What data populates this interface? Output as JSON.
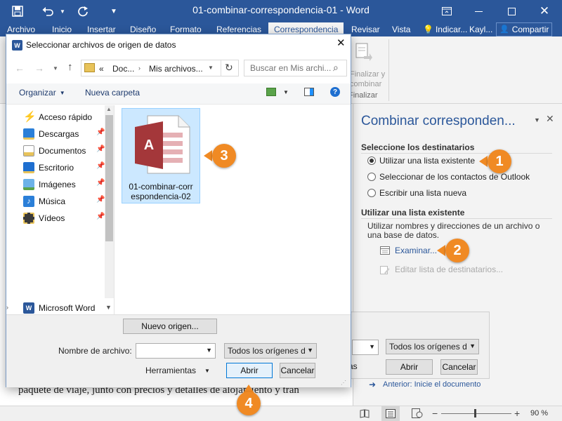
{
  "window": {
    "title": "01-combinar-correspondencia-01 - Word",
    "save_icon": "save-icon",
    "undo_icon": "undo-icon",
    "redo_icon": "redo-icon"
  },
  "ribbon": {
    "tabs": [
      {
        "label": "Archivo"
      },
      {
        "label": "Inicio"
      },
      {
        "label": "Insertar"
      },
      {
        "label": "Diseño"
      },
      {
        "label": "Formato"
      },
      {
        "label": "Referencias"
      },
      {
        "label": "Correspondencia",
        "active": true
      },
      {
        "label": "Revisar"
      },
      {
        "label": "Vista"
      }
    ],
    "tell_me": "Indicar...",
    "user": "Kayl...",
    "share": "Compartir",
    "finish_button_line1": "Finalizar y",
    "finish_button_line2": "combinar",
    "finish_group": "Finalizar"
  },
  "document": {
    "text": "paquete de viaje, junto con precios y detalles de alojamiento y tran"
  },
  "task_pane": {
    "title": "Combinar corresponden...",
    "section1": "Seleccione los destinatarios",
    "options": [
      {
        "label": "Utilizar una lista existente",
        "selected": true
      },
      {
        "label": "Seleccionar de los contactos de Outlook",
        "selected": false
      },
      {
        "label": "Escribir una lista nueva",
        "selected": false
      }
    ],
    "section2": "Utilizar una lista existente",
    "description": "Utilizar nombres y direcciones de un archivo o una base de datos.",
    "browse": "Examinar...",
    "edit_list": "Editar lista de destinatarios...",
    "prev_step": "Anterior: Inicie el documento"
  },
  "behind_dialog": {
    "filter": "Todos los orígenes d",
    "tools_partial": "as",
    "open": "Abrir",
    "cancel": "Cancelar"
  },
  "dialog": {
    "title": "Seleccionar archivos de origen de datos",
    "breadcrumb": [
      "«",
      "Doc...",
      "Mis archivos..."
    ],
    "search_placeholder": "Buscar en Mis archi...",
    "organize": "Organizar",
    "new_folder": "Nueva carpeta",
    "nav": [
      {
        "label": "Acceso rápido",
        "icon": "quick-access-icon",
        "pinned": false
      },
      {
        "label": "Descargas",
        "icon": "downloads-icon",
        "pinned": true
      },
      {
        "label": "Documentos",
        "icon": "documents-icon",
        "pinned": true
      },
      {
        "label": "Escritorio",
        "icon": "desktop-icon",
        "pinned": true
      },
      {
        "label": "Imágenes",
        "icon": "pictures-icon",
        "pinned": true
      },
      {
        "label": "Música",
        "icon": "music-icon",
        "pinned": true
      },
      {
        "label": "Vídeos",
        "icon": "videos-icon",
        "pinned": true
      }
    ],
    "nav_bottom": "Microsoft Word",
    "file": {
      "name": "01-combinar-correspondencia-02",
      "name_line1": "01-combinar-corr",
      "name_line2": "espondencia-02"
    },
    "new_source": "Nuevo origen...",
    "filename_label": "Nombre de archivo:",
    "filename_value": "",
    "filter": "Todos los orígenes d",
    "tools": "Herramientas",
    "open": "Abrir",
    "cancel": "Cancelar"
  },
  "status": {
    "zoom": "90 %"
  },
  "callouts": [
    "1",
    "2",
    "3",
    "4"
  ],
  "colors": {
    "word_blue": "#2b579a",
    "callout_orange": "#f08a24",
    "access_red": "#a4373a",
    "selection_blue": "#cce8ff"
  }
}
